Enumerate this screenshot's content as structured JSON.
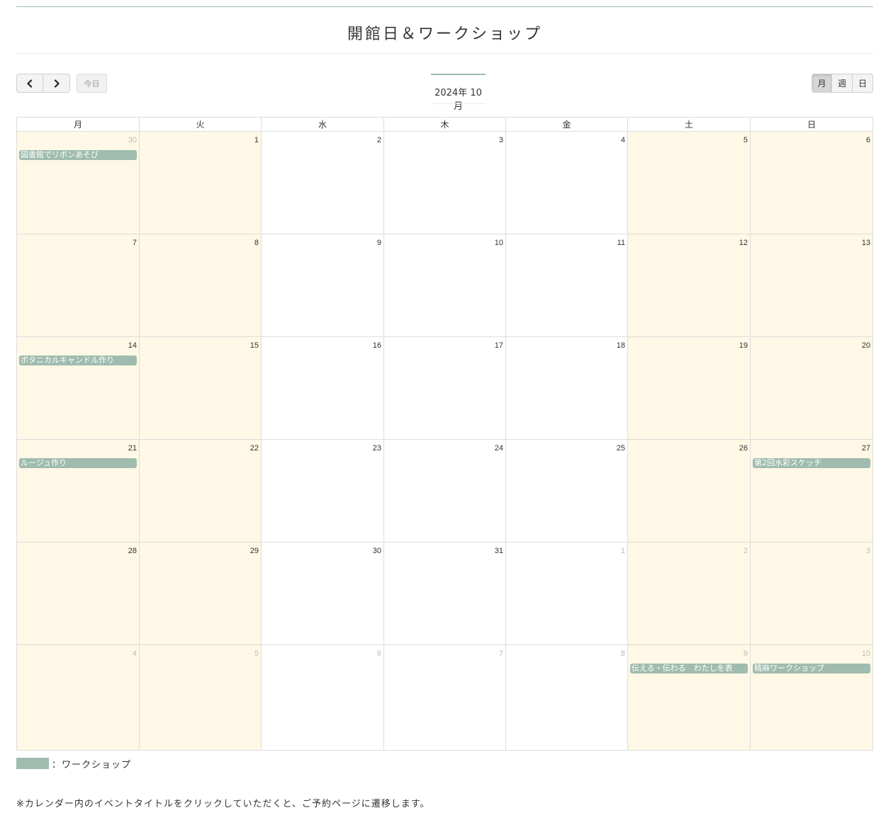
{
  "title": "開館日＆ワークショップ",
  "toolbar": {
    "prev_icon": "chevron-left-icon",
    "next_icon": "chevron-right-icon",
    "today_label": "今日",
    "month_label": "2024年 10月",
    "views": [
      "月",
      "週",
      "日"
    ],
    "active_view": "月"
  },
  "colors": {
    "accent": "#9fbcae",
    "open_day": "#fff8e6",
    "border": "#dddddd"
  },
  "weekdays": [
    "月",
    "火",
    "水",
    "木",
    "金",
    "土",
    "日"
  ],
  "weeks": [
    [
      {
        "num": "30",
        "other": true,
        "open": true,
        "event": "図書館でリボンあそび"
      },
      {
        "num": "1",
        "other": false,
        "open": true,
        "event": ""
      },
      {
        "num": "2",
        "other": false,
        "open": false,
        "event": ""
      },
      {
        "num": "3",
        "other": false,
        "open": false,
        "event": ""
      },
      {
        "num": "4",
        "other": false,
        "open": false,
        "event": ""
      },
      {
        "num": "5",
        "other": false,
        "open": true,
        "event": ""
      },
      {
        "num": "6",
        "other": false,
        "open": true,
        "event": ""
      }
    ],
    [
      {
        "num": "7",
        "other": false,
        "open": true,
        "event": ""
      },
      {
        "num": "8",
        "other": false,
        "open": true,
        "event": ""
      },
      {
        "num": "9",
        "other": false,
        "open": false,
        "event": ""
      },
      {
        "num": "10",
        "other": false,
        "open": false,
        "event": ""
      },
      {
        "num": "11",
        "other": false,
        "open": false,
        "event": ""
      },
      {
        "num": "12",
        "other": false,
        "open": true,
        "event": ""
      },
      {
        "num": "13",
        "other": false,
        "open": true,
        "event": ""
      }
    ],
    [
      {
        "num": "14",
        "other": false,
        "open": true,
        "event": "ボタニカルキャンドル作り"
      },
      {
        "num": "15",
        "other": false,
        "open": true,
        "event": ""
      },
      {
        "num": "16",
        "other": false,
        "open": false,
        "event": ""
      },
      {
        "num": "17",
        "other": false,
        "open": false,
        "event": ""
      },
      {
        "num": "18",
        "other": false,
        "open": false,
        "event": ""
      },
      {
        "num": "19",
        "other": false,
        "open": true,
        "event": ""
      },
      {
        "num": "20",
        "other": false,
        "open": true,
        "event": ""
      }
    ],
    [
      {
        "num": "21",
        "other": false,
        "open": true,
        "event": "ルージュ作り"
      },
      {
        "num": "22",
        "other": false,
        "open": true,
        "event": ""
      },
      {
        "num": "23",
        "other": false,
        "open": false,
        "event": ""
      },
      {
        "num": "24",
        "other": false,
        "open": false,
        "event": ""
      },
      {
        "num": "25",
        "other": false,
        "open": false,
        "event": ""
      },
      {
        "num": "26",
        "other": false,
        "open": true,
        "event": ""
      },
      {
        "num": "27",
        "other": false,
        "open": true,
        "event": "第2回水彩スケッチ"
      }
    ],
    [
      {
        "num": "28",
        "other": false,
        "open": true,
        "event": ""
      },
      {
        "num": "29",
        "other": false,
        "open": true,
        "event": ""
      },
      {
        "num": "30",
        "other": false,
        "open": false,
        "event": ""
      },
      {
        "num": "31",
        "other": false,
        "open": false,
        "event": ""
      },
      {
        "num": "1",
        "other": true,
        "open": false,
        "event": ""
      },
      {
        "num": "2",
        "other": true,
        "open": true,
        "event": ""
      },
      {
        "num": "3",
        "other": true,
        "open": true,
        "event": ""
      }
    ],
    [
      {
        "num": "4",
        "other": true,
        "open": true,
        "event": ""
      },
      {
        "num": "5",
        "other": true,
        "open": true,
        "event": ""
      },
      {
        "num": "6",
        "other": true,
        "open": false,
        "event": ""
      },
      {
        "num": "7",
        "other": true,
        "open": false,
        "event": ""
      },
      {
        "num": "8",
        "other": true,
        "open": false,
        "event": ""
      },
      {
        "num": "9",
        "other": true,
        "open": true,
        "event": "伝える・伝わる　わたしを表"
      },
      {
        "num": "10",
        "other": true,
        "open": true,
        "event": "精麻ワークショップ"
      }
    ]
  ],
  "legend": {
    "label": "：ワークショップ"
  },
  "note": "※カレンダー内のイベントタイトルをクリックしていただくと、ご予約ページに遷移します。"
}
